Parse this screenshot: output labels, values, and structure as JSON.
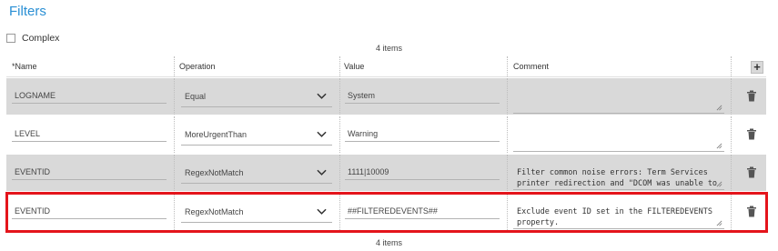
{
  "title": "Filters",
  "complex_label": "Complex",
  "item_count_top": "4 items",
  "item_count_bottom": "4 items",
  "columns": {
    "name": "*Name",
    "operation": "Operation",
    "value": "Value",
    "comment": "Comment"
  },
  "add_button_label": "+",
  "rows": [
    {
      "name": "LOGNAME",
      "operation": "Equal",
      "value": "System",
      "comment": ""
    },
    {
      "name": "LEVEL",
      "operation": "MoreUrgentThan",
      "value": "Warning",
      "comment": ""
    },
    {
      "name": "EVENTID",
      "operation": "RegexNotMatch",
      "value": "1111|10009",
      "comment": "Filter common noise errors: Term Services printer redirection and \"DCOM was unable to communicate\" messages"
    },
    {
      "name": "EVENTID",
      "operation": "RegexNotMatch",
      "value": "##FILTEREDEVENTS##",
      "comment": "Exclude event ID set in the FILTEREDEVENTS property."
    }
  ],
  "colors": {
    "title": "#2a8fd4",
    "row_shade": "#d9d9d9",
    "highlight": "#e4141b"
  },
  "icons": {
    "add": "plus-icon",
    "delete": "trash-icon",
    "dropdown": "chevron-down-icon",
    "resize": "resize-grip-icon"
  }
}
